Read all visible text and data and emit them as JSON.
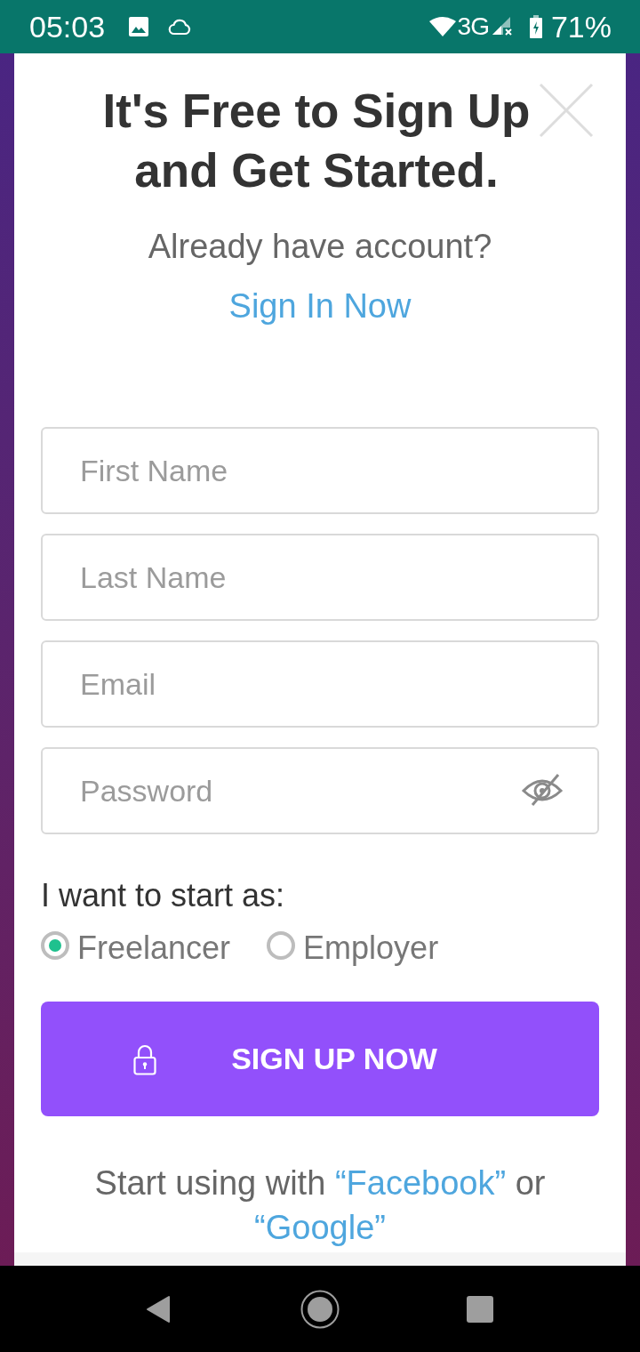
{
  "status_bar": {
    "time": "05:03",
    "network": "3G",
    "battery": "71%"
  },
  "heading": "It's Free to Sign Up and Get Started.",
  "signin_prompt": {
    "text": "Already have account?",
    "link": "Sign In Now"
  },
  "fields": [
    {
      "kind": "text",
      "placeholder": "First Name"
    },
    {
      "kind": "text",
      "placeholder": "Last Name"
    },
    {
      "kind": "email",
      "placeholder": "Email"
    },
    {
      "kind": "password",
      "placeholder": "Password"
    }
  ],
  "role": {
    "label": "I want to start as:",
    "options": [
      {
        "label": "Freelancer",
        "selected": true
      },
      {
        "label": "Employer",
        "selected": false
      }
    ]
  },
  "submit_button": "SIGN UP NOW",
  "social": {
    "text": "Start using with",
    "links": [
      "“Facebook”",
      "“Google”"
    ],
    "conjunction": "or"
  }
}
